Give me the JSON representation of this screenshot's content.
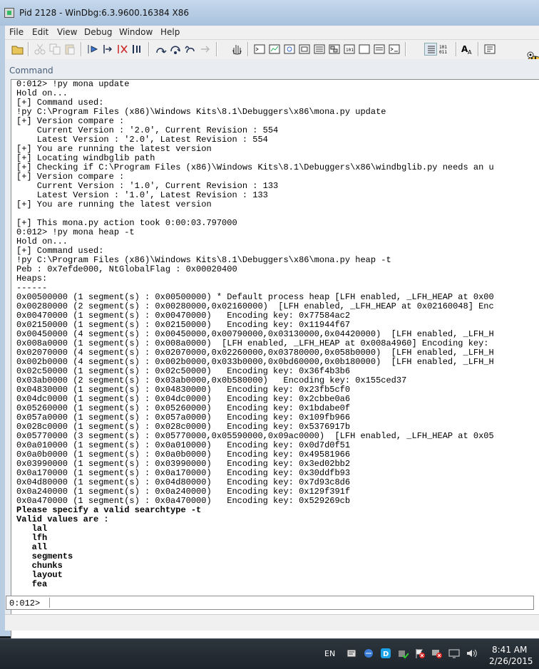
{
  "window": {
    "title": "Pid 2128 - WinDbg:6.3.9600.16384 X86"
  },
  "menu": [
    "File",
    "Edit",
    "View",
    "Debug",
    "Window",
    "Help"
  ],
  "panel": {
    "title": "Command"
  },
  "output_lines": [
    "0:012> !py mona update",
    "Hold on...",
    "[+] Command used:",
    "!py C:\\Program Files (x86)\\Windows Kits\\8.1\\Debuggers\\x86\\mona.py update",
    "[+] Version compare :",
    "    Current Version : '2.0', Current Revision : 554",
    "    Latest Version : '2.0', Latest Revision : 554",
    "[+] You are running the latest version",
    "[+] Locating windbglib path",
    "[+] Checking if C:\\Program Files (x86)\\Windows Kits\\8.1\\Debuggers\\x86\\windbglib.py needs an u",
    "[+] Version compare :",
    "    Current Version : '1.0', Current Revision : 133",
    "    Latest Version : '1.0', Latest Revision : 133",
    "[+] You are running the latest version",
    "",
    "[+] This mona.py action took 0:00:03.797000",
    "0:012> !py mona heap -t",
    "Hold on...",
    "[+] Command used:",
    "!py C:\\Program Files (x86)\\Windows Kits\\8.1\\Debuggers\\x86\\mona.py heap -t",
    "Peb : 0x7efde000, NtGlobalFlag : 0x00020400",
    "Heaps:",
    "------",
    "0x00500000 (1 segment(s) : 0x00500000) * Default process heap [LFH enabled, _LFH_HEAP at 0x00",
    "0x00280000 (2 segment(s) : 0x00280000,0x02160000)  [LFH enabled, _LFH_HEAP at 0x02160048] Enc",
    "0x00470000 (1 segment(s) : 0x00470000)   Encoding key: 0x77584ac2",
    "0x02150000 (1 segment(s) : 0x02150000)   Encoding key: 0x11944f67",
    "0x00450000 (4 segment(s) : 0x00450000,0x00790000,0x03130000,0x04420000)  [LFH enabled, _LFH_H",
    "0x008a0000 (1 segment(s) : 0x008a0000)  [LFH enabled, _LFH_HEAP at 0x008a4960] Encoding key:",
    "0x02070000 (4 segment(s) : 0x02070000,0x02260000,0x03780000,0x058b0000)  [LFH enabled, _LFH_H",
    "0x002b0000 (4 segment(s) : 0x002b0000,0x033b0000,0x0bd60000,0x0b180000)  [LFH enabled, _LFH_H",
    "0x02c50000 (1 segment(s) : 0x02c50000)   Encoding key: 0x36f4b3b6",
    "0x03ab0000 (2 segment(s) : 0x03ab0000,0x0b580000)   Encoding key: 0x155ced37",
    "0x04830000 (1 segment(s) : 0x04830000)   Encoding key: 0x23fb5cf0",
    "0x04dc0000 (1 segment(s) : 0x04dc0000)   Encoding key: 0x2cbbe0a6",
    "0x05260000 (1 segment(s) : 0x05260000)   Encoding key: 0x1bdabe0f",
    "0x057a0000 (1 segment(s) : 0x057a0000)   Encoding key: 0x109fb966",
    "0x028c0000 (1 segment(s) : 0x028c0000)   Encoding key: 0x5376917b",
    "0x05770000 (3 segment(s) : 0x05770000,0x05590000,0x09ac0000)  [LFH enabled, _LFH_HEAP at 0x05",
    "0x0a010000 (1 segment(s) : 0x0a010000)   Encoding key: 0x0d7d0f51",
    "0x0a0b0000 (1 segment(s) : 0x0a0b0000)   Encoding key: 0x49581966",
    "0x03990000 (1 segment(s) : 0x03990000)   Encoding key: 0x3ed02bb2",
    "0x0a170000 (1 segment(s) : 0x0a170000)   Encoding key: 0x30ddfb93",
    "0x04d80000 (1 segment(s) : 0x04d80000)   Encoding key: 0x7d93c8d6",
    "0x0a240000 (1 segment(s) : 0x0a240000)   Encoding key: 0x129f391f",
    "0x0a470000 (1 segment(s) : 0x0a470000)   Encoding key: 0x529269cb",
    ""
  ],
  "output_bold_lines": [
    "Please specify a valid searchtype -t",
    "Valid values are :",
    "   lal",
    "   lfh",
    "   all",
    "   segments",
    "   chunks",
    "   layout",
    "   fea"
  ],
  "command": {
    "prompt": "0:012>",
    "value": ""
  },
  "taskbar": {
    "language": "EN",
    "time": "8:41 AM",
    "date": "2/26/2015"
  }
}
